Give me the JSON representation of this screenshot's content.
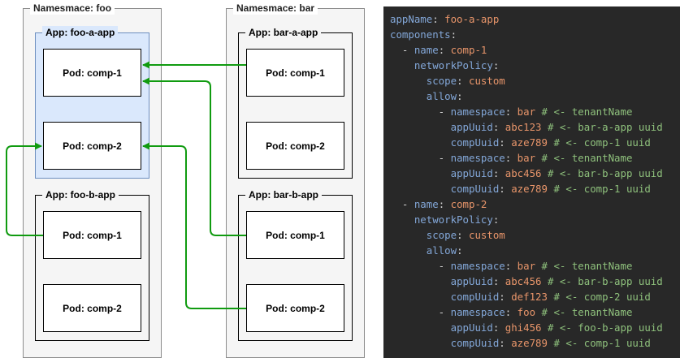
{
  "namespaces": {
    "foo": {
      "label": "Namesmace: foo",
      "apps": [
        {
          "label": "App: foo-a-app",
          "pods": [
            "Pod: comp-1",
            "Pod: comp-2"
          ]
        },
        {
          "label": "App: foo-b-app",
          "pods": [
            "Pod: comp-1",
            "Pod: comp-2"
          ]
        }
      ]
    },
    "bar": {
      "label": "Namesmace: bar",
      "apps": [
        {
          "label": "App: bar-a-app",
          "pods": [
            "Pod: comp-1",
            "Pod: comp-2"
          ]
        },
        {
          "label": "App: bar-b-app",
          "pods": [
            "Pod: comp-1",
            "Pod: comp-2"
          ]
        }
      ]
    }
  },
  "colors": {
    "arrow": "#109b10",
    "highlight_fill": "#dae8fc",
    "highlight_border": "#6c8ebf",
    "code_bg": "#282828",
    "code_key": "#83a7d8",
    "code_value": "#e8956a",
    "code_comment": "#8ec07c"
  },
  "yaml_lines": [
    [
      [
        "k",
        "appName"
      ],
      [
        "p",
        ": "
      ],
      [
        "v",
        "foo-a-app"
      ]
    ],
    [
      [
        "k",
        "components"
      ],
      [
        "p",
        ":"
      ]
    ],
    [
      [
        "p",
        "  - "
      ],
      [
        "k",
        "name"
      ],
      [
        "p",
        ": "
      ],
      [
        "v",
        "comp-1"
      ]
    ],
    [
      [
        "p",
        "    "
      ],
      [
        "k",
        "networkPolicy"
      ],
      [
        "p",
        ":"
      ]
    ],
    [
      [
        "p",
        "      "
      ],
      [
        "k",
        "scope"
      ],
      [
        "p",
        ": "
      ],
      [
        "v",
        "custom"
      ]
    ],
    [
      [
        "p",
        "      "
      ],
      [
        "k",
        "allow"
      ],
      [
        "p",
        ":"
      ]
    ],
    [
      [
        "p",
        "        - "
      ],
      [
        "k",
        "namespace"
      ],
      [
        "p",
        ": "
      ],
      [
        "v",
        "bar"
      ],
      [
        "c",
        " # <- tenantName"
      ]
    ],
    [
      [
        "p",
        "          "
      ],
      [
        "k",
        "appUuid"
      ],
      [
        "p",
        ": "
      ],
      [
        "v",
        "abc123"
      ],
      [
        "c",
        " # <- bar-a-app uuid"
      ]
    ],
    [
      [
        "p",
        "          "
      ],
      [
        "k",
        "compUuid"
      ],
      [
        "p",
        ": "
      ],
      [
        "v",
        "aze789"
      ],
      [
        "c",
        " # <- comp-1 uuid"
      ]
    ],
    [
      [
        "p",
        "        - "
      ],
      [
        "k",
        "namespace"
      ],
      [
        "p",
        ": "
      ],
      [
        "v",
        "bar"
      ],
      [
        "c",
        " # <- tenantName"
      ]
    ],
    [
      [
        "p",
        "          "
      ],
      [
        "k",
        "appUuid"
      ],
      [
        "p",
        ": "
      ],
      [
        "v",
        "abc456"
      ],
      [
        "c",
        " # <- bar-b-app uuid"
      ]
    ],
    [
      [
        "p",
        "          "
      ],
      [
        "k",
        "compUuid"
      ],
      [
        "p",
        ": "
      ],
      [
        "v",
        "aze789"
      ],
      [
        "c",
        " # <- comp-1 uuid"
      ]
    ],
    [
      [
        "p",
        "  - "
      ],
      [
        "k",
        "name"
      ],
      [
        "p",
        ": "
      ],
      [
        "v",
        "comp-2"
      ]
    ],
    [
      [
        "p",
        "    "
      ],
      [
        "k",
        "networkPolicy"
      ],
      [
        "p",
        ":"
      ]
    ],
    [
      [
        "p",
        "      "
      ],
      [
        "k",
        "scope"
      ],
      [
        "p",
        ": "
      ],
      [
        "v",
        "custom"
      ]
    ],
    [
      [
        "p",
        "      "
      ],
      [
        "k",
        "allow"
      ],
      [
        "p",
        ":"
      ]
    ],
    [
      [
        "p",
        "        - "
      ],
      [
        "k",
        "namespace"
      ],
      [
        "p",
        ": "
      ],
      [
        "v",
        "bar"
      ],
      [
        "c",
        " # <- tenantName"
      ]
    ],
    [
      [
        "p",
        "          "
      ],
      [
        "k",
        "appUuid"
      ],
      [
        "p",
        ": "
      ],
      [
        "v",
        "abc456"
      ],
      [
        "c",
        " # <- bar-b-app uuid"
      ]
    ],
    [
      [
        "p",
        "          "
      ],
      [
        "k",
        "compUuid"
      ],
      [
        "p",
        ": "
      ],
      [
        "v",
        "def123"
      ],
      [
        "c",
        " # <- comp-2 uuid"
      ]
    ],
    [
      [
        "p",
        "        - "
      ],
      [
        "k",
        "namespace"
      ],
      [
        "p",
        ": "
      ],
      [
        "v",
        "foo"
      ],
      [
        "c",
        " # <- tenantName"
      ]
    ],
    [
      [
        "p",
        "          "
      ],
      [
        "k",
        "appUuid"
      ],
      [
        "p",
        ": "
      ],
      [
        "v",
        "ghi456"
      ],
      [
        "c",
        " # <- foo-b-app uuid"
      ]
    ],
    [
      [
        "p",
        "          "
      ],
      [
        "k",
        "compUuid"
      ],
      [
        "p",
        ": "
      ],
      [
        "v",
        "aze789"
      ],
      [
        "c",
        " # <- comp-1 uuid"
      ]
    ]
  ]
}
